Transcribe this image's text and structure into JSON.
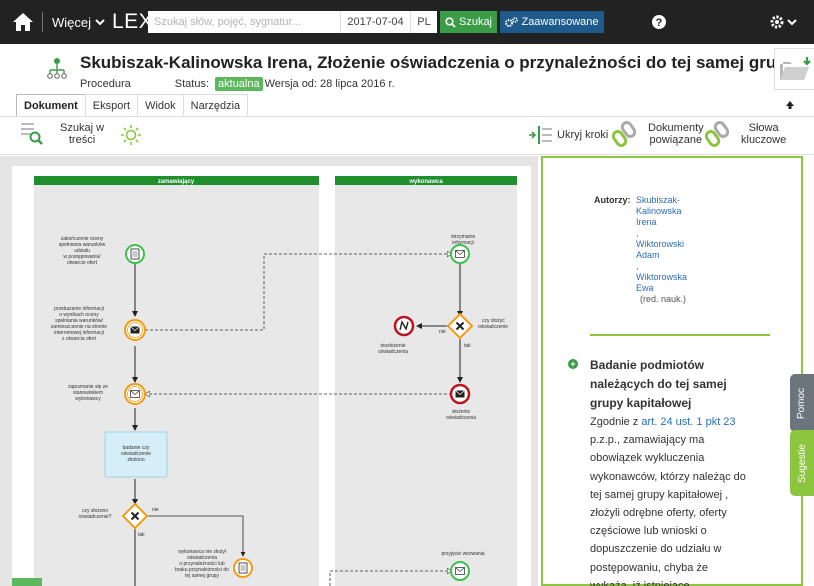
{
  "topbar": {
    "more_label": "Więcej",
    "brand": "LEX",
    "search_placeholder": "Szukaj słów, pojęć, sygnatur...",
    "date": "2017-07-04",
    "lang": "PL",
    "search_button": "Szukaj",
    "advanced_button": "Zaawansowane"
  },
  "document": {
    "title": "Skubiszak-Kalinowska Irena, Złożenie oświadczenia o przynależności do tej samej grupy kapitało...",
    "type": "Procedura",
    "status_label": "Status:",
    "status_value": "aktualna",
    "version": "Wersja od: 28 lipca 2016 r."
  },
  "tabs": [
    "Dokument",
    "Eksport",
    "Widok",
    "Narzędzia"
  ],
  "toolbar": {
    "search_in_content_1": "Szukaj w",
    "search_in_content_2": "treści",
    "hide_steps": "Ukryj kroki",
    "related_docs_1": "Dokumenty",
    "related_docs_2": "powiązane",
    "keywords_1": "Słowa",
    "keywords_2": "kluczowe"
  },
  "diagram": {
    "lane_left": "zamawiający",
    "lane_right": "wykonawca",
    "nodes": {
      "n1": [
        "zakończenie oceny",
        "spełniania warunków",
        "udziału",
        "w postępowaniu/",
        "otwarcie ofert"
      ],
      "n2": [
        "przekazanie informacji",
        "o wynikach oceny",
        "spełniania warunków/",
        "zamieszczenie na stronie",
        "internetowej informacji",
        "z otwarcia ofert"
      ],
      "n3": [
        "zapoznanie się ze",
        "stanowiskiem",
        "wykonawcy"
      ],
      "task": [
        "badanie czy",
        "oświadczenie",
        "złożono"
      ],
      "gw_left": [
        "czy złożono",
        "oświadczenie?"
      ],
      "gw_left_no": "nie",
      "gw_left_yes": "tak",
      "n_doc": [
        "wykonawca nie złożył",
        "oświadczenia",
        "o przynależności lub",
        "braku przynależności do",
        "tej samej grupy"
      ],
      "r1": [
        "otrzymanie",
        "informacji"
      ],
      "gw_right": [
        "czy złożyć",
        "oświadczenie"
      ],
      "gw_right_no": "nie",
      "gw_right_yes": "tak",
      "r_noresp": [
        "niezłożenie",
        "oświadczenia"
      ],
      "r_resp": [
        "złożenie",
        "oświadczenia"
      ],
      "r_call": "przyjęcie wezwania"
    }
  },
  "panel": {
    "authors_label": "Autorzy:",
    "authors": [
      "Skubiszak-",
      "Kalinowska",
      "Irena",
      ",",
      "Wiktorowski",
      "Adam",
      ",",
      "Wiktorowska",
      "Ewa"
    ],
    "editor_note": "(red. nauk.)",
    "section_title": "Badanie podmiotów należących do tej samej grupy kapitałowej",
    "body_prefix": "Zgodnie z ",
    "body_link": "art. 24 ust. 1 pkt 23",
    "body_text": "p.z.p., zamawiający ma obowiązek wykluczenia wykonawców, którzy należąc do tej samej grupy kapitałowej , złożyli odrębne oferty, oferty częściowe lub wnioski o dopuszczenie do udziału w postępowaniu, chyba że wykażą, iż istnieiace"
  },
  "sidetabs": {
    "help": "Pomoc",
    "suggestions": "Sugestie"
  },
  "colors": {
    "accent_green": "#8cc63f",
    "search_green": "#3a9c47",
    "advanced_blue": "#1e5a8c",
    "topbar": "#222222"
  }
}
